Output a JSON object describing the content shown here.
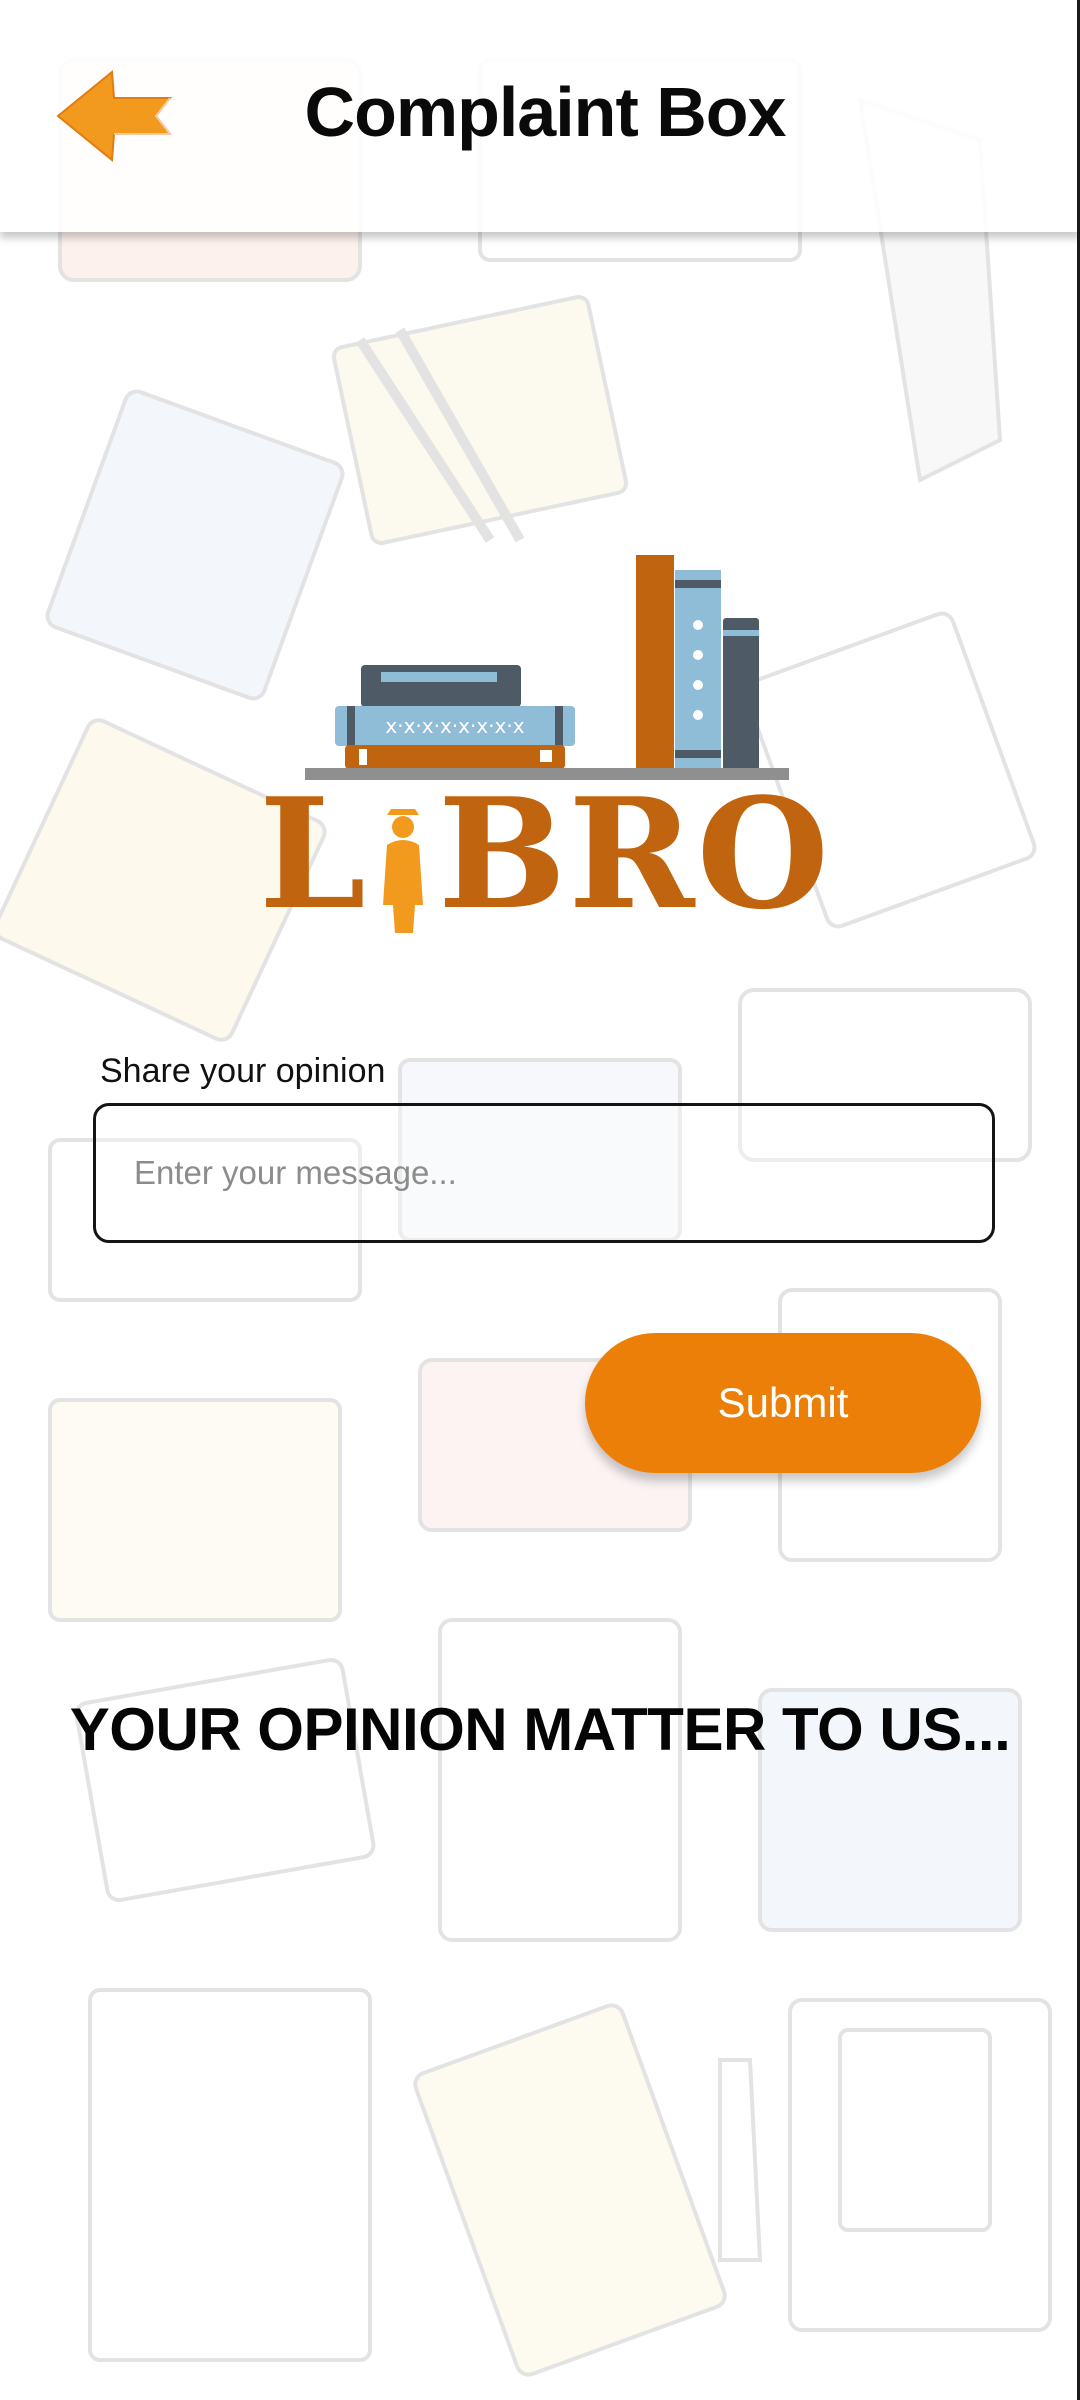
{
  "header": {
    "title": "Complaint Box",
    "back_icon": "arrow-left-icon"
  },
  "logo": {
    "text_before": "L",
    "text_after": "BRO",
    "colors": {
      "brand": "#C06410",
      "accent": "#F29A1E",
      "blue": "#8FBCD6",
      "slate": "#4E5A66"
    }
  },
  "form": {
    "label": "Share your opinion",
    "placeholder": "Enter your message...",
    "value": "",
    "submit_label": "Submit"
  },
  "tagline": "YOUR OPINION MATTER TO US...",
  "theme": {
    "accent": "#EC7F07",
    "text": "#0A0A0A"
  }
}
